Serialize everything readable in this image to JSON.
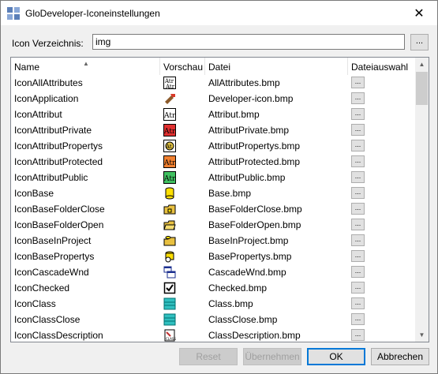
{
  "window": {
    "title": "GloDeveloper-Iconeinstellungen"
  },
  "directory": {
    "label": "Icon Verzeichnis:",
    "value": "img",
    "browse_label": "..."
  },
  "grid": {
    "columns": [
      "Name",
      "Vorschau",
      "Datei",
      "Dateiauswahl"
    ],
    "button_label": "...",
    "rows": [
      {
        "name": "IconAllAttributes",
        "file": "AllAttributes.bmp",
        "icon": "all-attributes-icon"
      },
      {
        "name": "IconApplication",
        "file": "Developer-icon.bmp",
        "icon": "application-icon"
      },
      {
        "name": "IconAttribut",
        "file": "Attribut.bmp",
        "icon": "attribut-icon"
      },
      {
        "name": "IconAttributPrivate",
        "file": "AttributPrivate.bmp",
        "icon": "attribut-private-icon"
      },
      {
        "name": "IconAttributPropertys",
        "file": "AttributPropertys.bmp",
        "icon": "attribut-propertys-icon"
      },
      {
        "name": "IconAttributProtected",
        "file": "AttributProtected.bmp",
        "icon": "attribut-protected-icon"
      },
      {
        "name": "IconAttributPublic",
        "file": "AttributPublic.bmp",
        "icon": "attribut-public-icon"
      },
      {
        "name": "IconBase",
        "file": "Base.bmp",
        "icon": "base-icon"
      },
      {
        "name": "IconBaseFolderClose",
        "file": "BaseFolderClose.bmp",
        "icon": "base-folder-close-icon"
      },
      {
        "name": "IconBaseFolderOpen",
        "file": "BaseFolderOpen.bmp",
        "icon": "base-folder-open-icon"
      },
      {
        "name": "IconBaseInProject",
        "file": "BaseInProject.bmp",
        "icon": "base-in-project-icon"
      },
      {
        "name": "IconBasePropertys",
        "file": "BasePropertys.bmp",
        "icon": "base-propertys-icon"
      },
      {
        "name": "IconCascadeWnd",
        "file": "CascadeWnd.bmp",
        "icon": "cascade-wnd-icon"
      },
      {
        "name": "IconChecked",
        "file": "Checked.bmp",
        "icon": "checked-icon"
      },
      {
        "name": "IconClass",
        "file": "Class.bmp",
        "icon": "class-icon"
      },
      {
        "name": "IconClassClose",
        "file": "ClassClose.bmp",
        "icon": "class-close-icon"
      },
      {
        "name": "IconClassDescription",
        "file": "ClassDescription.bmp",
        "icon": "class-description-icon"
      }
    ]
  },
  "buttons": {
    "reset": "Reset",
    "apply": "Übernehmen",
    "ok": "OK",
    "cancel": "Abbrechen"
  },
  "colors": {
    "accent": "#0078d7"
  }
}
